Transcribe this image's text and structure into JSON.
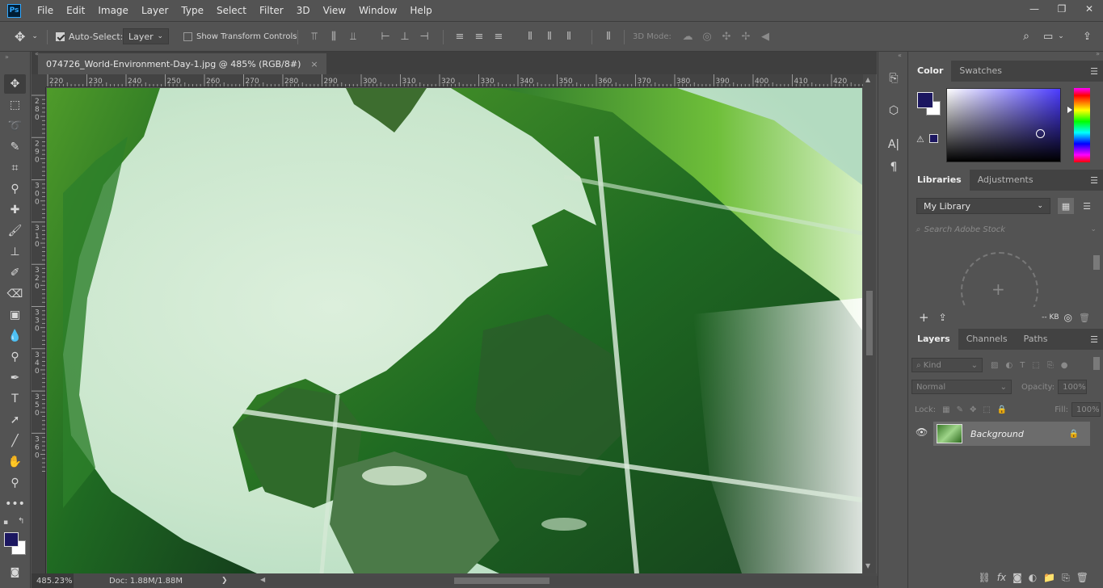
{
  "app": {
    "logo": "Ps"
  },
  "menu": [
    "File",
    "Edit",
    "Image",
    "Layer",
    "Type",
    "Select",
    "Filter",
    "3D",
    "View",
    "Window",
    "Help"
  ],
  "window_controls": {
    "minimize": "—",
    "restore": "❐",
    "close": "✕"
  },
  "options": {
    "auto_select_label": "Auto-Select:",
    "auto_select_checked": true,
    "auto_select_target": "Layer",
    "show_transform_label": "Show Transform Controls",
    "show_transform_checked": false,
    "mode_3d_label": "3D Mode:"
  },
  "document": {
    "tab_title": "074726_World-Environment-Day-1.jpg @ 485% (RGB/8#)",
    "close": "×"
  },
  "rulers": {
    "horizontal": [
      "220",
      "230",
      "240",
      "250",
      "260",
      "270",
      "280",
      "290",
      "300",
      "310",
      "320",
      "330",
      "340",
      "350",
      "360",
      "370",
      "380",
      "390",
      "400",
      "410",
      "420"
    ],
    "vertical": [
      "280",
      "290",
      "300",
      "310",
      "320",
      "330",
      "340",
      "350",
      "360"
    ]
  },
  "status": {
    "zoom": "485.23%",
    "doc_info": "Doc: 1.88M/1.88M",
    "arrow": "❯"
  },
  "panels": {
    "color": {
      "tabs": [
        "Color",
        "Swatches"
      ],
      "foreground": "#1c1760",
      "background": "#ffffff"
    },
    "libraries": {
      "tabs": [
        "Libraries",
        "Adjustments"
      ],
      "selected_library": "My Library",
      "search_placeholder": "Search Adobe Stock",
      "size_label": "-- KB"
    },
    "layers": {
      "tabs": [
        "Layers",
        "Channels",
        "Paths"
      ],
      "kind_placeholder": "Kind",
      "blend_mode": "Normal",
      "opacity_label": "Opacity:",
      "opacity_value": "100%",
      "lock_label": "Lock:",
      "fill_label": "Fill:",
      "fill_value": "100%",
      "items": [
        {
          "name": "Background",
          "locked": true,
          "visible": true
        }
      ]
    }
  }
}
